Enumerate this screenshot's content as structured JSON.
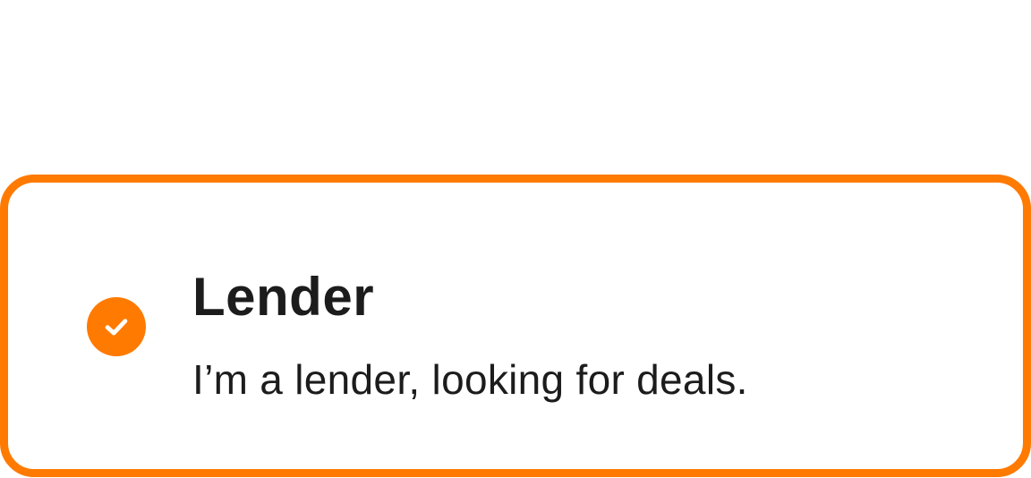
{
  "option": {
    "title": "Lender",
    "description": "I’m a lender, looking for deals.",
    "selected": true,
    "icon": "check-circle-icon"
  },
  "colors": {
    "accent": "#ff7a00",
    "text": "#1c1c1c",
    "background": "#ffffff"
  }
}
